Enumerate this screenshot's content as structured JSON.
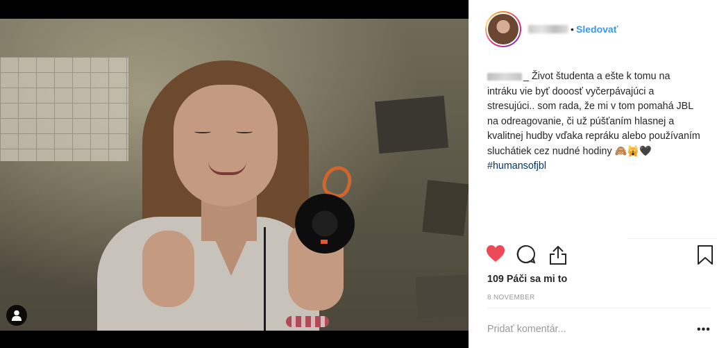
{
  "post": {
    "username_display": "",
    "follow_label": "Sledovať",
    "separator": "•",
    "caption_text": "Život študenta a ešte k tomu na intráku vie byť dooosť vyčerpávajúci a stresujúci.. som rada, že mi v tom pomahá JBL na odreagovanie, či už púšťaním hlasnej a kvalitnej hudby vďaka repráku alebo používaním sluchátiek cez nudné hodiny 🙈🙀🖤",
    "caption_prefix": "_",
    "hashtag": "#humansofjbl",
    "likes_text": "109 Páči sa mi to",
    "date_text": "8 NOVEMBER",
    "comment_placeholder": "Pridať komentár...",
    "more_label": "•••"
  },
  "icons": {
    "like": "heart-icon",
    "comment": "comment-icon",
    "share": "share-icon",
    "save": "bookmark-icon",
    "tag": "user-tag-icon"
  },
  "colors": {
    "like_red": "#ed4956",
    "follow_blue": "#3897f0",
    "hashtag_blue": "#003569"
  }
}
